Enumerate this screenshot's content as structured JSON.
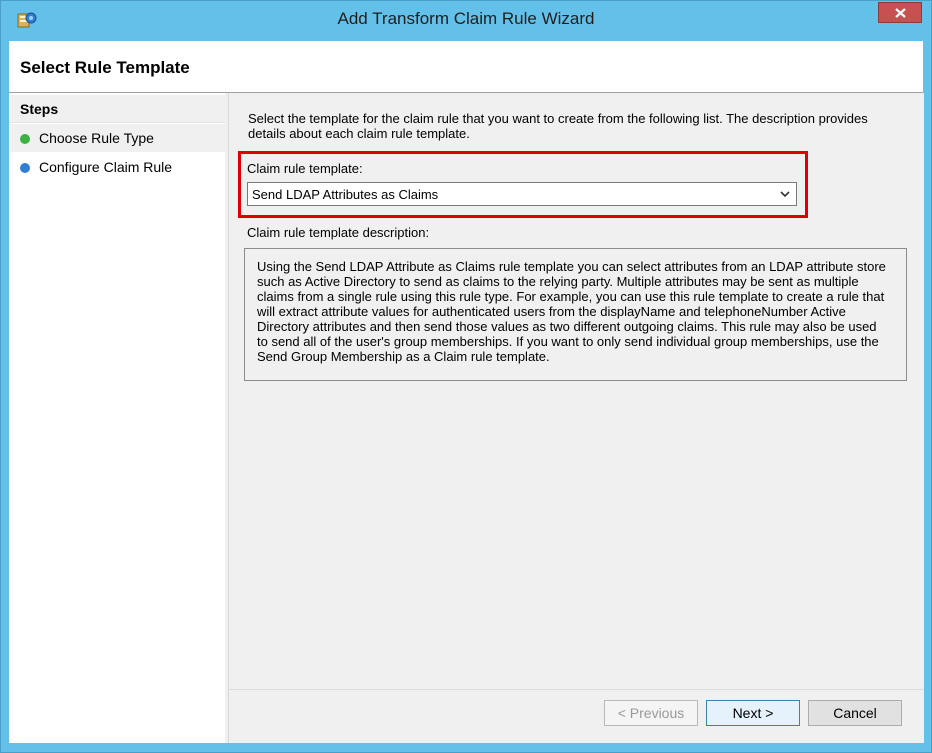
{
  "window": {
    "title": "Add Transform Claim Rule Wizard",
    "app_icon": "adfs-wizard-icon",
    "close_icon": "close-icon"
  },
  "header": {
    "title": "Select Rule Template"
  },
  "steps": {
    "title": "Steps",
    "items": [
      {
        "label": "Choose Rule Type",
        "status": "completed",
        "color": "#3cb043"
      },
      {
        "label": "Configure Claim Rule",
        "status": "current",
        "color": "#2f7fd6"
      }
    ]
  },
  "main": {
    "intro": "Select the template for the claim rule that you want to create from the following list. The description provides details about each claim rule template.",
    "template_label": "Claim rule template:",
    "template_value": "Send LDAP Attributes as Claims",
    "description_label": "Claim rule template description:",
    "description": "Using the Send LDAP Attribute as Claims rule template you can select attributes from an LDAP attribute store such as Active Directory to send as claims to the relying party. Multiple attributes may be sent as multiple claims from a single rule using this rule type. For example, you can use this rule template to create a rule that will extract attribute values for authenticated users from the displayName and telephoneNumber Active Directory attributes and then send those values as two different outgoing claims. This rule may also be used to send all of the user's group memberships. If you want to only send individual group memberships, use the Send Group Membership as a Claim rule template."
  },
  "buttons": {
    "previous": "< Previous",
    "next": "Next >",
    "cancel": "Cancel"
  },
  "colors": {
    "titlebar": "#63c1e9",
    "highlight": "#e00000",
    "close_button": "#c75050"
  }
}
